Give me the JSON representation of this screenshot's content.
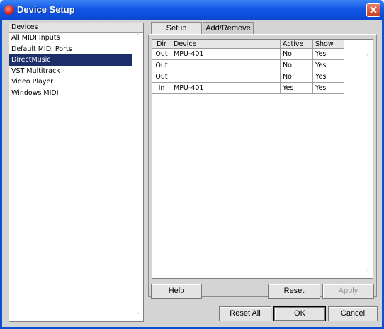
{
  "window": {
    "title": "Device Setup"
  },
  "devices": {
    "header": "Devices",
    "items": [
      "All MIDI Inputs",
      "Default MIDI Ports",
      "DirectMusic",
      "VST Multitrack",
      "Video Player",
      "Windows MIDI"
    ],
    "selected": "DirectMusic"
  },
  "tabs": [
    {
      "label": "Setup",
      "active": true
    },
    {
      "label": "Add/Remove",
      "active": false
    }
  ],
  "grid": {
    "columns": [
      "Dir",
      "Device",
      "Active",
      "Show"
    ],
    "rows": [
      [
        "Out",
        "MPU-401",
        "No",
        "Yes"
      ],
      [
        "Out",
        "",
        "No",
        "Yes"
      ],
      [
        "Out",
        "",
        "No",
        "Yes"
      ],
      [
        "In",
        "MPU-401",
        "Yes",
        "Yes"
      ]
    ]
  },
  "buttons": {
    "help": "Help",
    "reset": "Reset",
    "apply": "Apply",
    "reset_all": "Reset All",
    "ok": "OK",
    "cancel": "Cancel"
  },
  "colors": {
    "title_bar": "#1357e6",
    "selection": "#1e2e6a",
    "dialog_bg": "#d4d4d4"
  },
  "icons": {
    "title": "app-icon",
    "close": "close-icon"
  }
}
